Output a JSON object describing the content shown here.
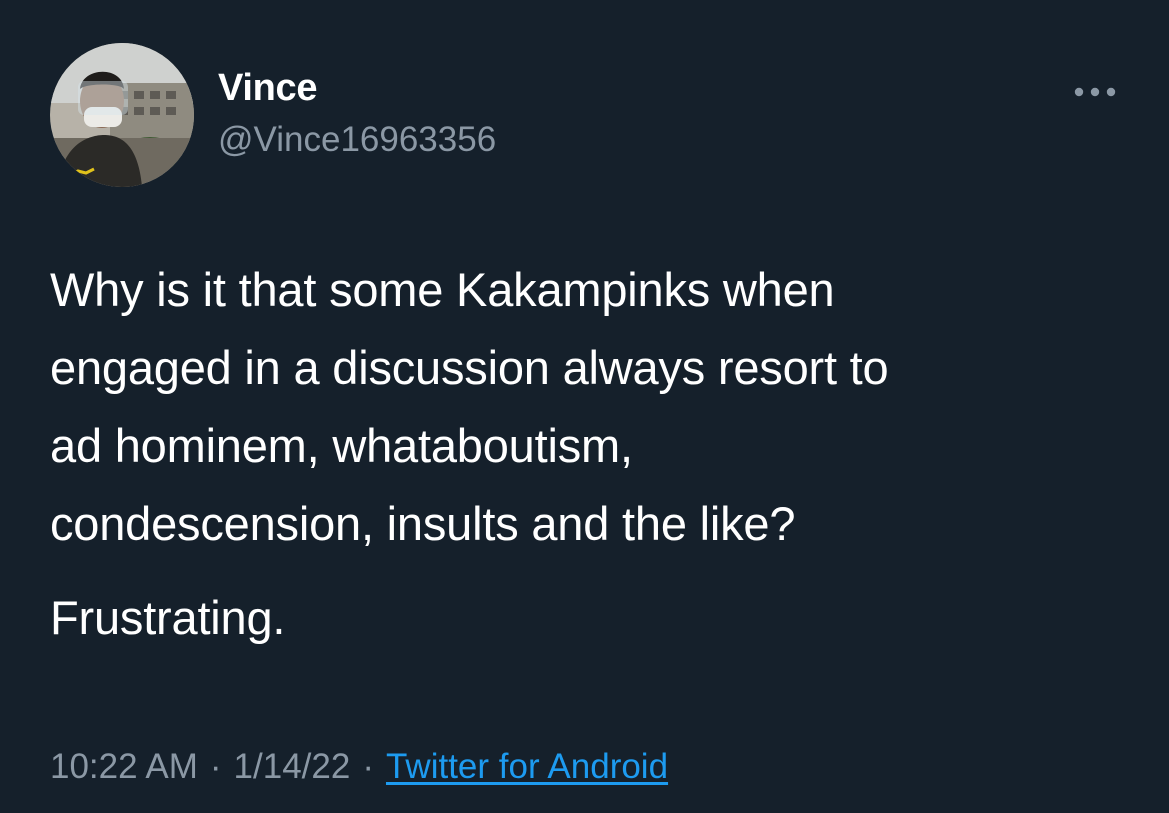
{
  "user": {
    "display_name": "Vince",
    "handle": "@Vince16963356",
    "avatar_icon": "profile-photo"
  },
  "tweet": {
    "paragraphs": [
      [
        "Why is it that some Kakampinks when",
        "engaged in a discussion always resort to",
        "ad hominem, whataboutism,",
        "condescension, insults and the like?"
      ],
      [
        "Frustrating."
      ]
    ]
  },
  "meta": {
    "time": "10:22 AM",
    "separator": "·",
    "date": "1/14/22",
    "source": "Twitter for Android"
  },
  "icons": {
    "more": "more-horizontal-icon"
  },
  "colors": {
    "background": "#15202b",
    "primary_text": "#ffffff",
    "secondary_text": "#8b98a5",
    "link": "#1d9bf0"
  }
}
